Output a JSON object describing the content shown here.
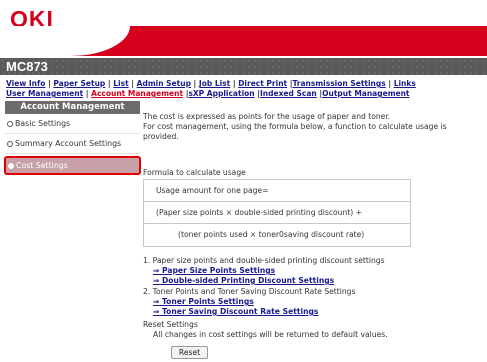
{
  "brand": {
    "logo": "OKI"
  },
  "model": {
    "name": "MC873"
  },
  "nav": {
    "row1": [
      "View Info",
      "Paper Setup",
      "List",
      "Admin Setup",
      "Job List",
      "Direct Print",
      "Transmission Settings",
      "Links"
    ],
    "row2": [
      "User Management",
      "Account Management",
      "sXP Application",
      "Indexed Scan",
      "Output Management"
    ]
  },
  "sidebar": {
    "title": "Account Management",
    "items": [
      {
        "label": "Basic Settings"
      },
      {
        "label": "Summary Account Settings"
      },
      {
        "label": "Cost Settings"
      }
    ]
  },
  "content": {
    "intro1": "The cost is expressed as points for the usage of paper and toner.",
    "intro2": "For cost management, using the formula below, a function to calculate usage is",
    "intro3": "provided.",
    "formula_label": "Formula to calculate usage",
    "formula": [
      "Usage amount for one page=",
      "(Paper size points × double-sided printing discount) +",
      "(toner points used × toner0saving discount rate)"
    ],
    "section1_title": "1. Paper size points and double-sided printing discount settings",
    "section1_links": [
      "⇒ Paper Size Points Settings",
      "⇒ Double-sided Printing Discount Settings"
    ],
    "section2_title": "2. Toner Points and Toner Saving Discount Rate Settings",
    "section2_links": [
      "⇒ Toner Points Settings",
      "⇒ Toner Saving Discount Rate Settings"
    ],
    "reset_title": "Reset Settings",
    "reset_desc": "All changes in cost settings will be returned to default values.",
    "reset_button": "Reset"
  },
  "colors": {
    "brand_red": "#d6001c",
    "link_blue": "#1a1a8c",
    "sidebar_header": "#6b6b6b",
    "selected_item": "#c8a0a8"
  }
}
